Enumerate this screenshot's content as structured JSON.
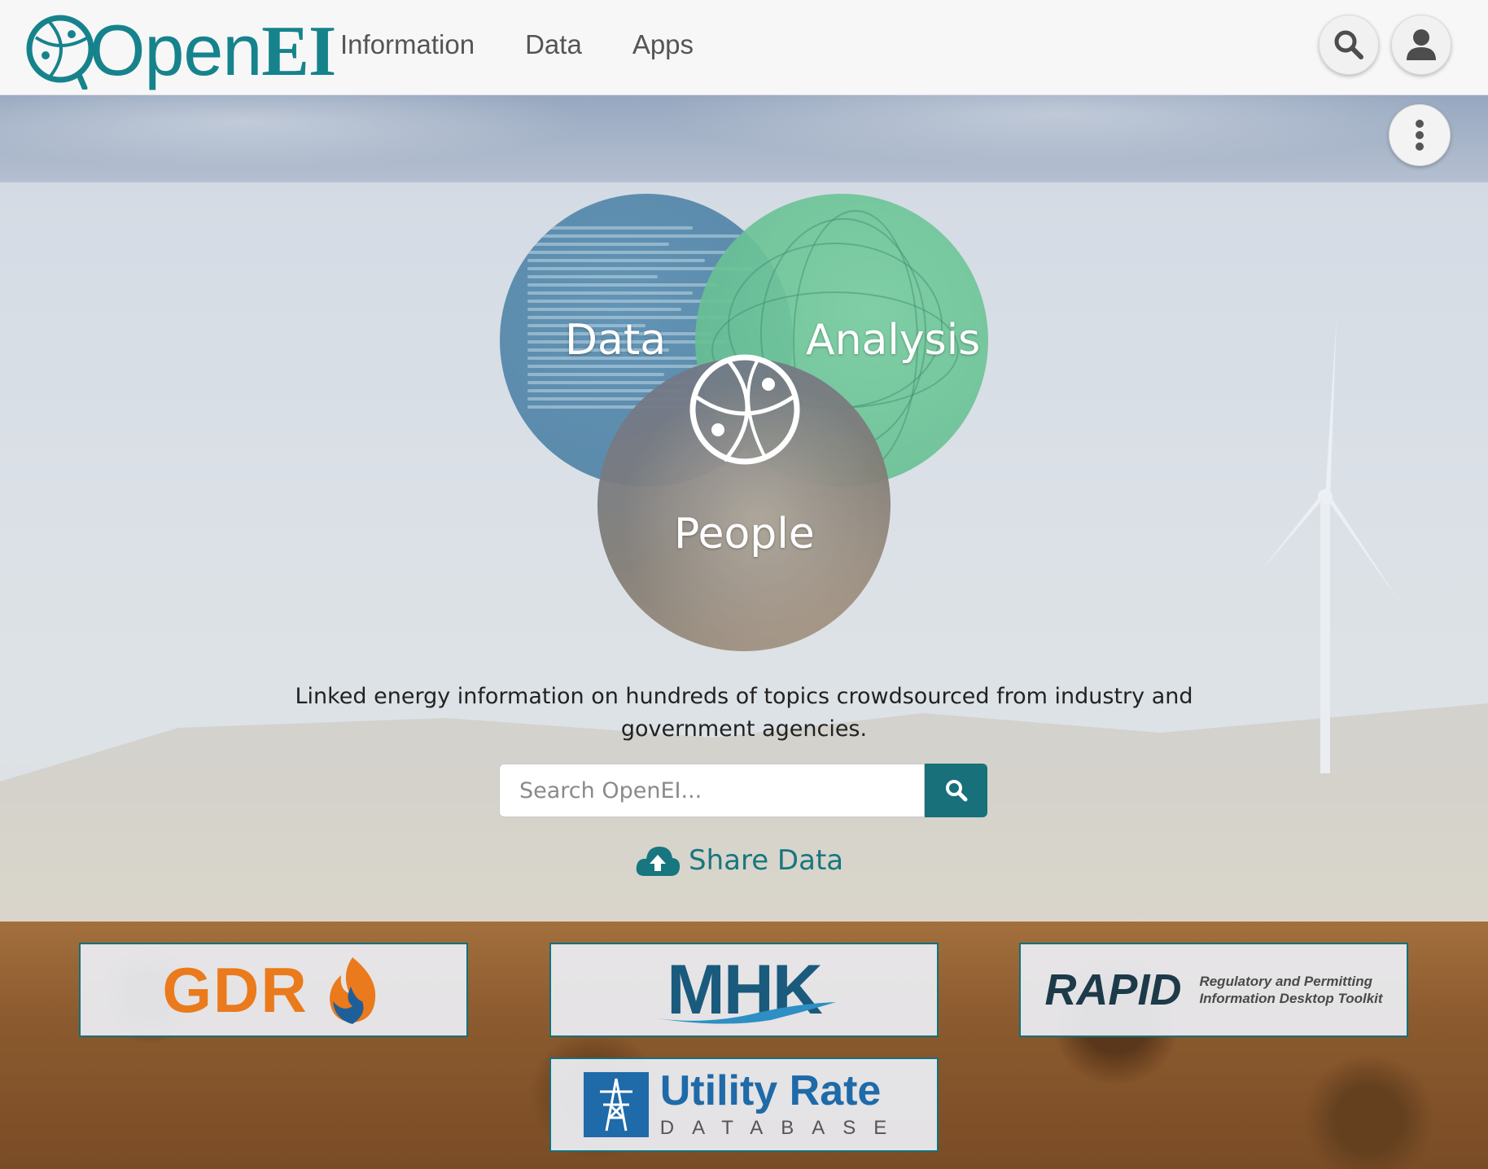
{
  "nav": {
    "logo_open": "Open",
    "logo_ei": "EI",
    "links": [
      "Information",
      "Data",
      "Apps"
    ]
  },
  "icons": {
    "search": "search-icon",
    "user": "user-icon",
    "more": "more-vertical-icon",
    "globe": "globe-network-icon",
    "cloud_upload": "cloud-upload-icon",
    "search_submit": "search-icon"
  },
  "hero": {
    "venn": {
      "data": "Data",
      "analysis": "Analysis",
      "people": "People"
    },
    "tagline": "Linked energy information on hundreds of topics crowdsourced from industry and government agencies.",
    "search_placeholder": "Search OpenEI...",
    "share_data": "Share Data"
  },
  "apps": {
    "gdr": "GDR",
    "mhk": "MHK",
    "rapid": "RAPID",
    "rapid_sub_1": "Regulatory and Permitting",
    "rapid_sub_2": "Information Desktop Toolkit",
    "urdb_title": "Utility Rate",
    "urdb_sub": "DATABASE"
  },
  "colors": {
    "brand_teal": "#16838c",
    "search_button": "#17707a",
    "gdr_orange": "#ea7a1c",
    "mhk_blue": "#1a5a7d",
    "urdb_blue": "#1f6aa8"
  }
}
